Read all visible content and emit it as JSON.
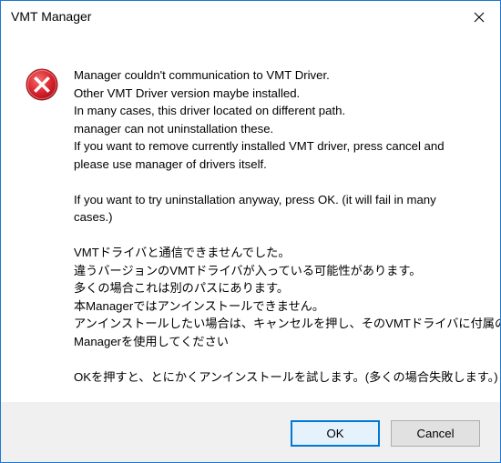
{
  "window": {
    "title": "VMT Manager"
  },
  "icons": {
    "close": "close-icon",
    "error": "error-icon",
    "error_color": "#e81123"
  },
  "message": {
    "lines": [
      "Manager couldn't communication to VMT Driver.",
      "Other VMT Driver version maybe installed.",
      "In many cases, this driver located on different path.",
      "manager can not uninstallation these.",
      "If you want to remove currently installed VMT driver, press cancel and",
      "please use manager of drivers itself.",
      "",
      "If you want to try uninstallation anyway, press OK. (it will fail in many",
      "cases.)",
      "",
      "VMTドライバと通信できませんでした。",
      "違うバージョンのVMTドライバが入っている可能性があります。",
      "多くの場合これは別のパスにあります。",
      "本Managerではアンインストールできません。",
      "アンインストールしたい場合は、キャンセルを押し、そのVMTドライバに付属の",
      "Managerを使用してください",
      "",
      "OKを押すと、とにかくアンインストールを試します。(多くの場合失敗します。)"
    ]
  },
  "buttons": {
    "ok_label": "OK",
    "cancel_label": "Cancel"
  }
}
